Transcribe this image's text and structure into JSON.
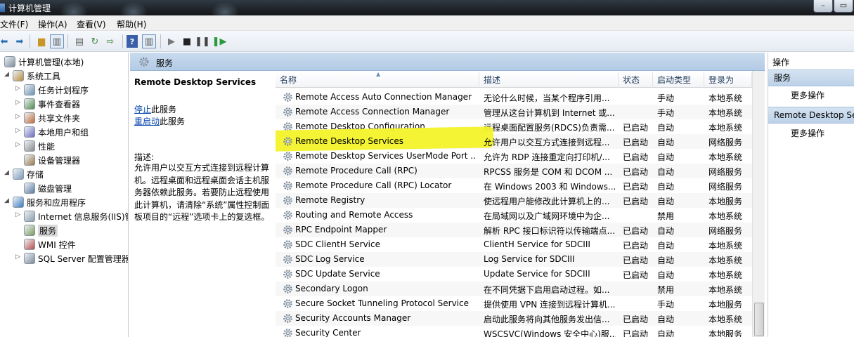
{
  "window": {
    "title": "计算机管理"
  },
  "menubar": [
    "文件(F)",
    "操作(A)",
    "查看(V)",
    "帮助(H)"
  ],
  "toolbar": {
    "buttons": [
      "back-icon",
      "forward-icon",
      "up-folder-icon",
      "show-hide-tree-icon",
      "properties-icon",
      "refresh-icon",
      "export-list-icon",
      "help-icon",
      "show-hide-action-pane-icon",
      "start-service-icon",
      "stop-service-icon",
      "pause-service-icon",
      "restart-service-icon"
    ]
  },
  "tree": {
    "root": "计算机管理(本地)",
    "items": [
      {
        "label": "系统工具",
        "level": 1,
        "expander": "◢"
      },
      {
        "label": "任务计划程序",
        "level": 2,
        "expander": "▷"
      },
      {
        "label": "事件查看器",
        "level": 2,
        "expander": "▷"
      },
      {
        "label": "共享文件夹",
        "level": 2,
        "expander": "▷"
      },
      {
        "label": "本地用户和组",
        "level": 2,
        "expander": "▷"
      },
      {
        "label": "性能",
        "level": 2,
        "expander": "▷"
      },
      {
        "label": "设备管理器",
        "level": 2,
        "expander": ""
      },
      {
        "label": "存储",
        "level": 1,
        "expander": "◢"
      },
      {
        "label": "磁盘管理",
        "level": 2,
        "expander": ""
      },
      {
        "label": "服务和应用程序",
        "level": 1,
        "expander": "◢"
      },
      {
        "label": "Internet 信息服务(IIS)管",
        "level": 2,
        "expander": "▷"
      },
      {
        "label": "服务",
        "level": 2,
        "expander": "",
        "selected": true
      },
      {
        "label": "WMI 控件",
        "level": 2,
        "expander": ""
      },
      {
        "label": "SQL Server 配置管理器",
        "level": 2,
        "expander": "▷"
      }
    ]
  },
  "middle": {
    "header": "服务",
    "service_name": "Remote Desktop Services",
    "stop_link": "停止",
    "stop_suffix": "此服务",
    "restart_link": "重启动",
    "restart_suffix": "此服务",
    "desc_label": "描述:",
    "desc_text": "允许用户以交互方式连接到远程计算机。远程桌面和远程桌面会话主机服务器依赖此服务。若要防止远程使用此计算机，请清除“系统”属性控制面板项目的“远程”选项卡上的复选框。"
  },
  "columns": [
    "名称",
    "描述",
    "状态",
    "启动类型",
    "登录为"
  ],
  "services": [
    {
      "name": "Remote Access Auto Connection Manager",
      "desc": "无论什么时候，当某个程序引用...",
      "status": "",
      "startup": "手动",
      "logon": "本地系统"
    },
    {
      "name": "Remote Access Connection Manager",
      "desc": "管理从这台计算机到 Internet 或...",
      "status": "",
      "startup": "手动",
      "logon": "本地系统"
    },
    {
      "name": "Remote Desktop Configuration",
      "desc": "远程桌面配置服务(RDCS)负责需...",
      "status": "已启动",
      "startup": "自动",
      "logon": "本地系统"
    },
    {
      "name": "Remote Desktop Services",
      "desc": "允许用户以交互方式连接到远程...",
      "status": "已启动",
      "startup": "自动",
      "logon": "网络服务",
      "highlight": true
    },
    {
      "name": "Remote Desktop Services UserMode Port ...",
      "desc": "允许为 RDP 连接重定向打印机/...",
      "status": "已启动",
      "startup": "自动",
      "logon": "本地系统"
    },
    {
      "name": "Remote Procedure Call (RPC)",
      "desc": "RPCSS 服务是 COM 和 DCOM ...",
      "status": "已启动",
      "startup": "自动",
      "logon": "网络服务"
    },
    {
      "name": "Remote Procedure Call (RPC) Locator",
      "desc": "在 Windows 2003 和 Windows...",
      "status": "已启动",
      "startup": "自动",
      "logon": "网络服务"
    },
    {
      "name": "Remote Registry",
      "desc": "使远程用户能修改此计算机上的...",
      "status": "已启动",
      "startup": "自动",
      "logon": "本地服务"
    },
    {
      "name": "Routing and Remote Access",
      "desc": "在局域网以及广域网环境中为企...",
      "status": "",
      "startup": "禁用",
      "logon": "本地系统"
    },
    {
      "name": "RPC Endpoint Mapper",
      "desc": "解析 RPC 接口标识符以传输端点...",
      "status": "已启动",
      "startup": "自动",
      "logon": "网络服务"
    },
    {
      "name": "SDC ClientH Service",
      "desc": "ClientH Service for SDCIII",
      "status": "已启动",
      "startup": "自动",
      "logon": "本地系统"
    },
    {
      "name": "SDC Log Service",
      "desc": "Log Service for SDCIII",
      "status": "已启动",
      "startup": "自动",
      "logon": "本地系统"
    },
    {
      "name": "SDC Update Service",
      "desc": "Update Service for SDCIII",
      "status": "已启动",
      "startup": "自动",
      "logon": "本地系统"
    },
    {
      "name": "Secondary Logon",
      "desc": "在不同凭据下启用启动过程。如...",
      "status": "",
      "startup": "禁用",
      "logon": "本地系统"
    },
    {
      "name": "Secure Socket Tunneling Protocol Service",
      "desc": "提供使用 VPN 连接到远程计算机...",
      "status": "",
      "startup": "手动",
      "logon": "本地服务"
    },
    {
      "name": "Security Accounts Manager",
      "desc": "启动此服务将向其他服务发出信...",
      "status": "已启动",
      "startup": "自动",
      "logon": "本地系统"
    },
    {
      "name": "Security Center",
      "desc": "WSCSVC(Windows 安全中心)服...",
      "status": "已启动",
      "startup": "自动",
      "logon": "本地服务"
    }
  ],
  "actions": {
    "title": "操作",
    "sections": [
      {
        "header": "服务",
        "item": "更多操作"
      },
      {
        "header": "Remote Desktop Services",
        "item": "更多操作"
      }
    ]
  },
  "colors": {
    "highlight": "#f3f32a",
    "pane_header": "#bcd1e8",
    "link": "#0645ad"
  }
}
